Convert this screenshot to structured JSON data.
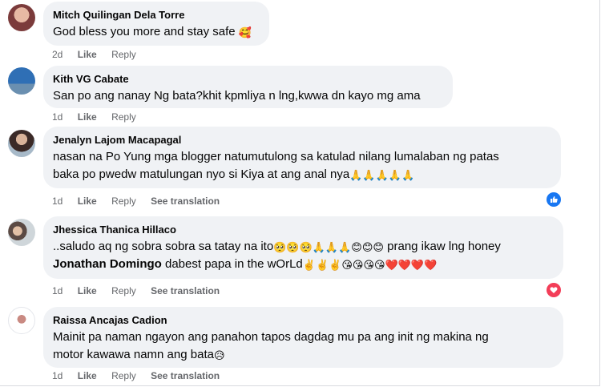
{
  "comments": [
    {
      "name": "Mitch Quilingan Dela Torre",
      "line1": "God bless you more and stay safe",
      "time": "2d",
      "like": "Like",
      "reply": "Reply"
    },
    {
      "name": "Kith VG Cabate",
      "line1": "San po ang nanay Ng bata?khit kpmliya n lng,kwwa dn kayo mg ama",
      "time": "1d",
      "like": "Like",
      "reply": "Reply"
    },
    {
      "name": "Jenalyn Lajom Macapagal",
      "line1": "nasan na Po Yung mga blogger natumutulong sa katulad nilang lumalaban ng patas",
      "line2": "baka po pwedw matulungan nyo si Kiya at ang anal nya",
      "time": "1d",
      "like": "Like",
      "reply": "Reply",
      "translate": "See translation",
      "reaction": "like"
    },
    {
      "name": "Jhessica Thanica Hillaco",
      "line1a": "..saludo aq ng sobra sobra sa tatay na ito",
      "line1b": "prang ikaw lng honey",
      "mention": "Jonathan Domingo",
      "line2": " dabest papa in the wOrLd",
      "time": "1d",
      "like": "Like",
      "reply": "Reply",
      "translate": "See translation",
      "reaction": "love"
    },
    {
      "name": "Raissa Ancajas Cadion",
      "line1": "Mainit pa naman ngayon ang panahon tapos dagdag mu pa ang init ng makina ng",
      "line2": "motor kawawa namn ang bata",
      "time": "1d",
      "like": "Like",
      "reply": "Reply",
      "translate": "See translation"
    }
  ],
  "colors": {
    "bubble": "#f0f2f5",
    "meta": "#65676b",
    "like_blue": "#1877f2",
    "love_red": "#f33e58"
  }
}
